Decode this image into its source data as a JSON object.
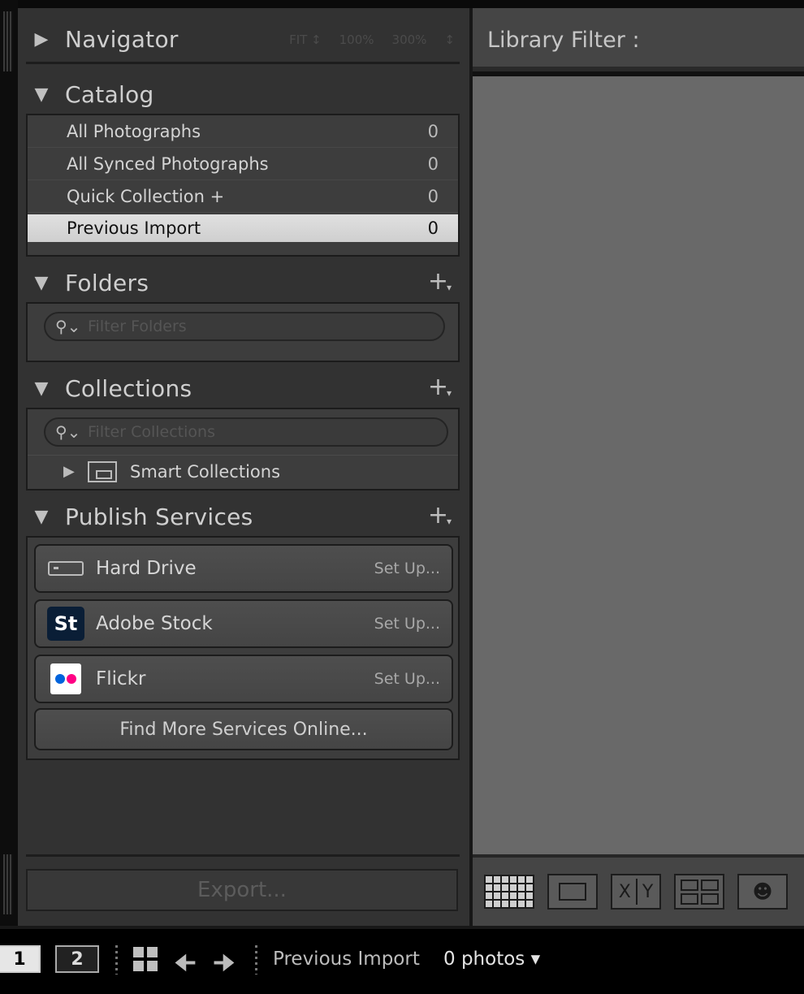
{
  "navigator": {
    "title": "Navigator",
    "zoom_options": [
      "FIT ↕",
      "100%",
      "300%",
      "↕"
    ]
  },
  "catalog": {
    "title": "Catalog",
    "items": [
      {
        "label": "All Photographs",
        "count": "0"
      },
      {
        "label": "All Synced Photographs",
        "count": "0"
      },
      {
        "label": "Quick Collection  +",
        "count": "0"
      },
      {
        "label": "Previous Import",
        "count": "0"
      }
    ]
  },
  "folders": {
    "title": "Folders",
    "filter_placeholder": "Filter Folders"
  },
  "collections": {
    "title": "Collections",
    "filter_placeholder": "Filter Collections",
    "smart_collections": "Smart Collections"
  },
  "publish": {
    "title": "Publish Services",
    "services": [
      {
        "name": "Hard Drive",
        "action": "Set Up..."
      },
      {
        "name": "Adobe Stock",
        "action": "Set Up..."
      },
      {
        "name": "Flickr",
        "action": "Set Up..."
      }
    ],
    "find_more": "Find More Services Online...",
    "stock_logo": "St"
  },
  "export_label": "Export...",
  "library_filter": "Library Filter :",
  "filmstrip": {
    "monitor1": "1",
    "monitor2": "2",
    "source": "Previous Import",
    "count": "0 photos ▾"
  },
  "toolbar": {
    "compare_x": "X",
    "compare_y": "Y"
  },
  "colors": {
    "flickr_blue": "#0063dc",
    "flickr_pink": "#ff0084",
    "stock_bg": "#0a1e36"
  }
}
